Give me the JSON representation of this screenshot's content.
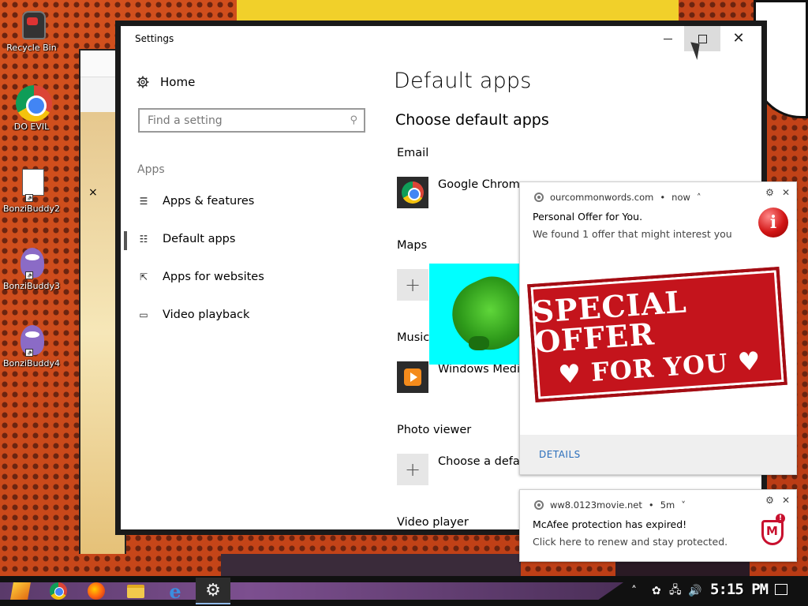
{
  "desktop": {
    "icons": [
      {
        "label": "Recycle Bin"
      },
      {
        "label": "DO EVIL"
      },
      {
        "label": "BonziBuddy2"
      },
      {
        "label": "BonziBuddy3"
      },
      {
        "label": "BonziBuddy4"
      }
    ],
    "stray_close": "×"
  },
  "window": {
    "title": "Settings",
    "minimize": "",
    "maximize": "",
    "close": "✕"
  },
  "nav": {
    "home": "Home",
    "search_placeholder": "Find a setting",
    "section": "Apps",
    "items": [
      {
        "label": "Apps & features"
      },
      {
        "label": "Default apps"
      },
      {
        "label": "Apps for websites"
      },
      {
        "label": "Video playback"
      }
    ]
  },
  "content": {
    "page_title": "Default apps",
    "section_title": "Choose default apps",
    "categories": [
      {
        "label": "Email",
        "app": "Google Chrome"
      },
      {
        "label": "Maps",
        "app": ""
      },
      {
        "label": "Music",
        "app": "Windows Media"
      },
      {
        "label": "Photo viewer",
        "app": "Choose a defau"
      },
      {
        "label": "Video player",
        "app": ""
      }
    ]
  },
  "notifications": [
    {
      "source": "ourcommonwords.com",
      "time": "now",
      "title": "Personal Offer for You.",
      "body": "We found 1 offer that might interest you",
      "image_text_1": "SPECIAL OFFER",
      "image_text_2": "♥ FOR YOU ♥",
      "action": "DETAILS",
      "badge": "i"
    },
    {
      "source": "ww8.0123movie.net",
      "time": "5m",
      "title": "McAfee protection has expired!",
      "body": "Click here to renew and stay protected."
    }
  ],
  "taskbar": {
    "clock": "5:15 PM"
  },
  "colors": {
    "accent_link": "#2a6ebb",
    "offer_red": "#c4141c",
    "mcafee_red": "#c8102e"
  }
}
